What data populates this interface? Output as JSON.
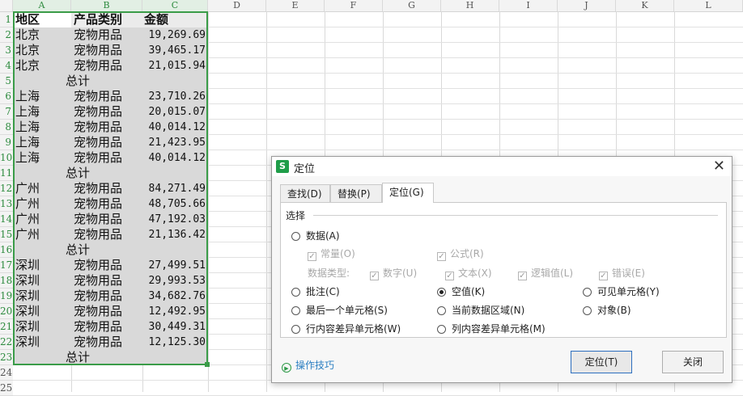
{
  "spreadsheet": {
    "columns": [
      "A",
      "B",
      "C",
      "D",
      "E",
      "F",
      "G",
      "H",
      "I",
      "J",
      "K",
      "L"
    ],
    "row_numbers": [
      "1",
      "2",
      "3",
      "4",
      "5",
      "6",
      "7",
      "8",
      "9",
      "10",
      "11",
      "12",
      "13",
      "14",
      "15",
      "16",
      "17",
      "18",
      "19",
      "20",
      "21",
      "22",
      "23",
      "24",
      "25"
    ],
    "header": {
      "region": "地区",
      "category": "产品类别",
      "amount": "金额"
    },
    "rows": [
      {
        "region": "北京",
        "category": "宠物用品",
        "amount": "19,269.69"
      },
      {
        "region": "北京",
        "category": "宠物用品",
        "amount": "39,465.17"
      },
      {
        "region": "北京",
        "category": "宠物用品",
        "amount": "21,015.94"
      },
      {
        "region": "",
        "category": "总计",
        "amount": "",
        "subtotal": true
      },
      {
        "region": "上海",
        "category": "宠物用品",
        "amount": "23,710.26"
      },
      {
        "region": "上海",
        "category": "宠物用品",
        "amount": "20,015.07"
      },
      {
        "region": "上海",
        "category": "宠物用品",
        "amount": "40,014.12"
      },
      {
        "region": "上海",
        "category": "宠物用品",
        "amount": "21,423.95"
      },
      {
        "region": "上海",
        "category": "宠物用品",
        "amount": "40,014.12"
      },
      {
        "region": "",
        "category": "总计",
        "amount": "",
        "subtotal": true
      },
      {
        "region": "广州",
        "category": "宠物用品",
        "amount": "84,271.49"
      },
      {
        "region": "广州",
        "category": "宠物用品",
        "amount": "48,705.66"
      },
      {
        "region": "广州",
        "category": "宠物用品",
        "amount": "47,192.03"
      },
      {
        "region": "广州",
        "category": "宠物用品",
        "amount": "21,136.42"
      },
      {
        "region": "",
        "category": "总计",
        "amount": "",
        "subtotal": true
      },
      {
        "region": "深圳",
        "category": "宠物用品",
        "amount": "27,499.51"
      },
      {
        "region": "深圳",
        "category": "宠物用品",
        "amount": "29,993.53"
      },
      {
        "region": "深圳",
        "category": "宠物用品",
        "amount": "34,682.76"
      },
      {
        "region": "深圳",
        "category": "宠物用品",
        "amount": "12,492.95"
      },
      {
        "region": "深圳",
        "category": "宠物用品",
        "amount": "30,449.31"
      },
      {
        "region": "深圳",
        "category": "宠物用品",
        "amount": "12,125.30"
      },
      {
        "region": "",
        "category": "总计",
        "amount": "",
        "subtotal": true
      }
    ],
    "colors": {
      "selection": "#3a9c48",
      "selected_fill": "#d9d9d9"
    }
  },
  "dialog": {
    "title": "定位",
    "app_icon": "wps-s-icon",
    "tabs": [
      {
        "label": "查找(D)",
        "active": false
      },
      {
        "label": "替换(P)",
        "active": false
      },
      {
        "label": "定位(G)",
        "active": true
      }
    ],
    "group_label": "选择",
    "options": {
      "data": "数据(A)",
      "constants": "常量(O)",
      "formulas": "公式(R)",
      "data_type_label": "数据类型:",
      "number": "数字(U)",
      "text": "文本(X)",
      "logical": "逻辑值(L)",
      "error": "错误(E)",
      "comments": "批注(C)",
      "blanks": "空值(K)",
      "visible_cells": "可见单元格(Y)",
      "last_cell": "最后一个单元格(S)",
      "current_region": "当前数据区域(N)",
      "objects": "对象(B)",
      "row_differences": "行内容差异单元格(W)",
      "column_differences": "列内容差异单元格(M)"
    },
    "selected_option": "blanks",
    "tips_label": "操作技巧",
    "locate_button": "定位(T)",
    "close_button": "关闭"
  }
}
